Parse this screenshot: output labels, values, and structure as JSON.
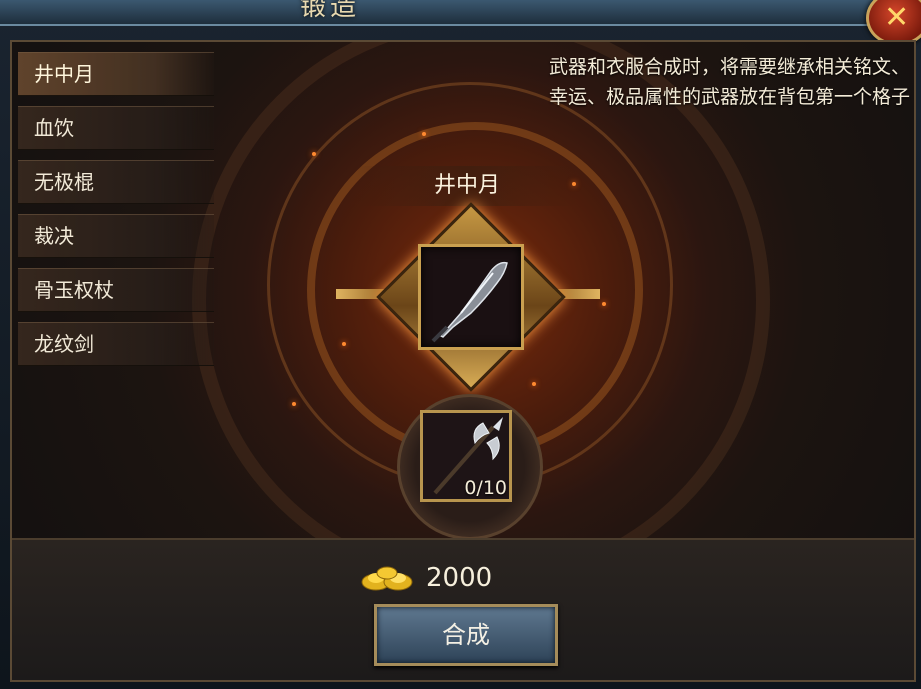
{
  "window": {
    "title": "锻造",
    "close_icon": "close-icon"
  },
  "sidebar": {
    "items": [
      {
        "label": "井中月",
        "active": true
      },
      {
        "label": "血饮",
        "active": false
      },
      {
        "label": "无极棍",
        "active": false
      },
      {
        "label": "裁决",
        "active": false
      },
      {
        "label": "骨玉权杖",
        "active": false
      },
      {
        "label": "龙纹剑",
        "active": false
      }
    ]
  },
  "notice": {
    "line1": "武器和衣服合成时，将需要继承相关铭文、",
    "line2": "幸运、极品属性的武器放在背包第一个格子"
  },
  "craft": {
    "item_name": "井中月",
    "main_item_icon": "broadsword-icon",
    "material_icon": "halberd-icon",
    "material_count": "0/10",
    "cost_icon": "gold-ingot-icon",
    "cost_value": "2000",
    "button_label": "合成"
  },
  "colors": {
    "accent_gold": "#c9a35a",
    "button_blue": "#4a6378",
    "glow_orange": "#ff8a30"
  }
}
